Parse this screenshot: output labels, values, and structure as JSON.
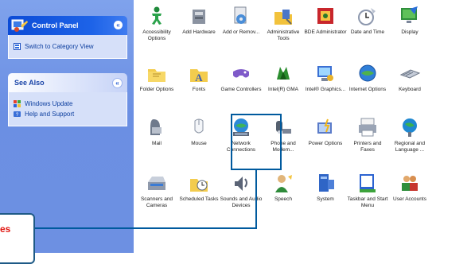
{
  "sidebar": {
    "control_panel": {
      "title": "Control Panel",
      "switch_link": "Switch to Category View"
    },
    "see_also": {
      "title": "See Also",
      "links": [
        "Windows Update",
        "Help and Support"
      ]
    }
  },
  "icons": [
    {
      "label": "Accessibility Options",
      "icon": "accessibility-icon"
    },
    {
      "label": "Add Hardware",
      "icon": "add-hardware-icon"
    },
    {
      "label": "Add or Remov...",
      "icon": "add-remove-programs-icon"
    },
    {
      "label": "Administrative Tools",
      "icon": "administrative-tools-icon"
    },
    {
      "label": "BDE Administrator",
      "icon": "bde-administrator-icon"
    },
    {
      "label": "Date and Time",
      "icon": "date-time-icon"
    },
    {
      "label": "Display",
      "icon": "display-icon"
    },
    {
      "label": "Folder Options",
      "icon": "folder-options-icon"
    },
    {
      "label": "Fonts",
      "icon": "fonts-icon"
    },
    {
      "label": "Game Controllers",
      "icon": "game-controllers-icon"
    },
    {
      "label": "Intel(R) GMA",
      "icon": "intel-gma-icon"
    },
    {
      "label": "Intel® Graphics...",
      "icon": "intel-graphics-icon"
    },
    {
      "label": "Internet Options",
      "icon": "internet-options-icon"
    },
    {
      "label": "Keyboard",
      "icon": "keyboard-icon"
    },
    {
      "label": "Mail",
      "icon": "mail-icon"
    },
    {
      "label": "Mouse",
      "icon": "mouse-icon"
    },
    {
      "label": "Network Connections",
      "icon": "network-connections-icon"
    },
    {
      "label": "Phone and Modem...",
      "icon": "phone-modem-icon"
    },
    {
      "label": "Power Options",
      "icon": "power-options-icon"
    },
    {
      "label": "Printers and Faxes",
      "icon": "printers-faxes-icon"
    },
    {
      "label": "Regional and Language ...",
      "icon": "regional-language-icon"
    },
    {
      "label": "Scanners and Cameras",
      "icon": "scanners-cameras-icon"
    },
    {
      "label": "Scheduled Tasks",
      "icon": "scheduled-tasks-icon"
    },
    {
      "label": "Sounds and Audio Devices",
      "icon": "sounds-audio-icon"
    },
    {
      "label": "Speech",
      "icon": "speech-icon"
    },
    {
      "label": "System",
      "icon": "system-icon"
    },
    {
      "label": "Taskbar and Start Menu",
      "icon": "taskbar-start-menu-icon"
    },
    {
      "label": "User Accounts",
      "icon": "user-accounts-icon"
    }
  ],
  "callout": {
    "text": "es"
  },
  "colors": {
    "taskpane": "#6d90e2",
    "highlight_border": "#005a9e",
    "callout_text": "#e0150f"
  }
}
